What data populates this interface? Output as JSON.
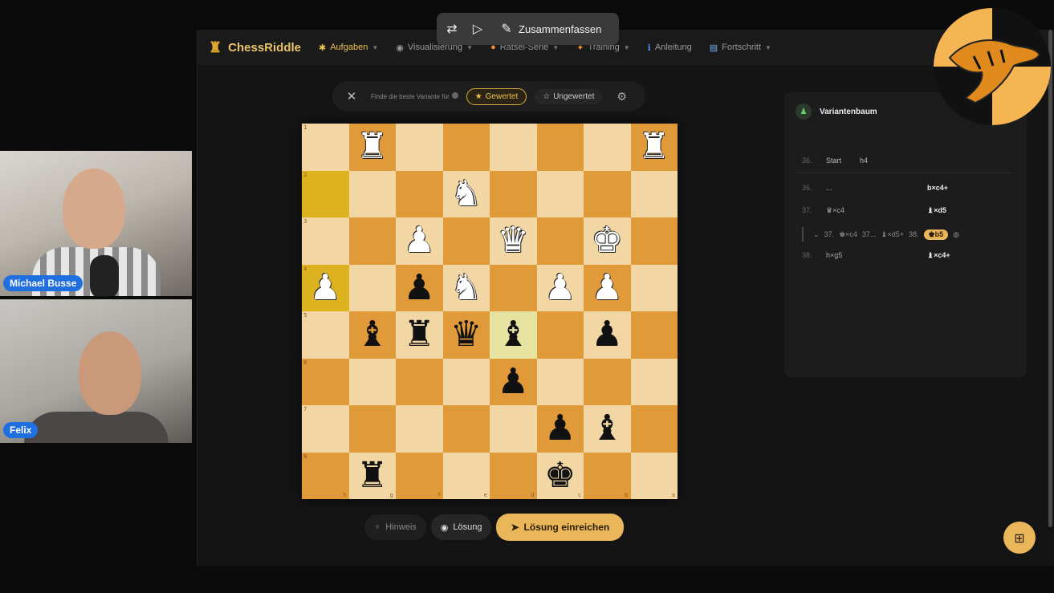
{
  "toolbar": {
    "summarize_label": "Zusammenfassen"
  },
  "participants": [
    {
      "name": "Michael Busse"
    },
    {
      "name": "Felix"
    }
  ],
  "app": {
    "brand": "ChessRiddle",
    "nav": [
      {
        "label": "Aufgaben",
        "icon": "puzzle-icon",
        "active": true
      },
      {
        "label": "Visualisierung",
        "icon": "brain-icon"
      },
      {
        "label": "Rätsel-Serie",
        "icon": "fire-icon"
      },
      {
        "label": "Training",
        "icon": "runner-icon"
      },
      {
        "label": "Anleitung",
        "icon": "info-icon"
      },
      {
        "label": "Fortschritt",
        "icon": "chart-icon"
      }
    ],
    "puzzle_bar": {
      "prompt": "Finde die beste Variante für",
      "rated_label": "Gewertet",
      "unrated_label": "Ungewertet"
    },
    "buttons": {
      "hint": "Hinweis",
      "solution": "Lösung",
      "submit": "Lösung einreichen"
    },
    "tree": {
      "title": "Variantenbaum",
      "rows": [
        {
          "num": "36.",
          "white": "Start",
          "black": "h4"
        },
        {
          "num": "36.",
          "white": "...",
          "black": "b×c4+"
        },
        {
          "num": "37.",
          "white": "♛×c4",
          "black": "♝×d5"
        },
        {
          "num": "38.",
          "white": "h×g5",
          "black": "♝×c4+"
        }
      ],
      "variation": {
        "n1": "37.",
        "m1": "♚×c4",
        "n2": "37...",
        "m2": "♝×d5+",
        "n3": "38.",
        "m3": "♚b5"
      }
    }
  },
  "board": {
    "ranks": [
      "1",
      "2",
      "3",
      "4",
      "5",
      "6",
      "7",
      "8"
    ],
    "files": [
      "h",
      "g",
      "f",
      "e",
      "d",
      "c",
      "b",
      "a"
    ],
    "pieces": [
      "  R    R ",
      "         ",
      "         ",
      "         ",
      "         ",
      "         ",
      "         ",
      "         "
    ]
  }
}
